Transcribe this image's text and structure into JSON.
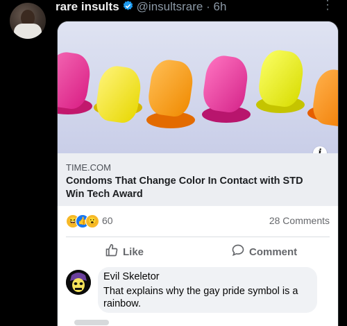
{
  "tweet": {
    "display_name": "rare insults",
    "handle": "@insultsrare",
    "separator": "·",
    "time": "6h",
    "verified_icon": "verified-badge-icon",
    "more_icon": "more-vertical-icon"
  },
  "post": {
    "domain": "TIME.COM",
    "title": "Condoms That Change Color In Contact with STD Win Tech Award",
    "reaction_count": "60",
    "comments_count": "28 Comments",
    "like_label": "Like",
    "comment_label": "Comment",
    "info_icon": "info-icon"
  },
  "comment": {
    "author": "Evil Skeletor",
    "text": "That explains why the gay pride symbol is a rainbow."
  },
  "colors": {
    "background": "#000000",
    "verified": "#1d9bf0",
    "handle_gray": "#8b98a5"
  }
}
